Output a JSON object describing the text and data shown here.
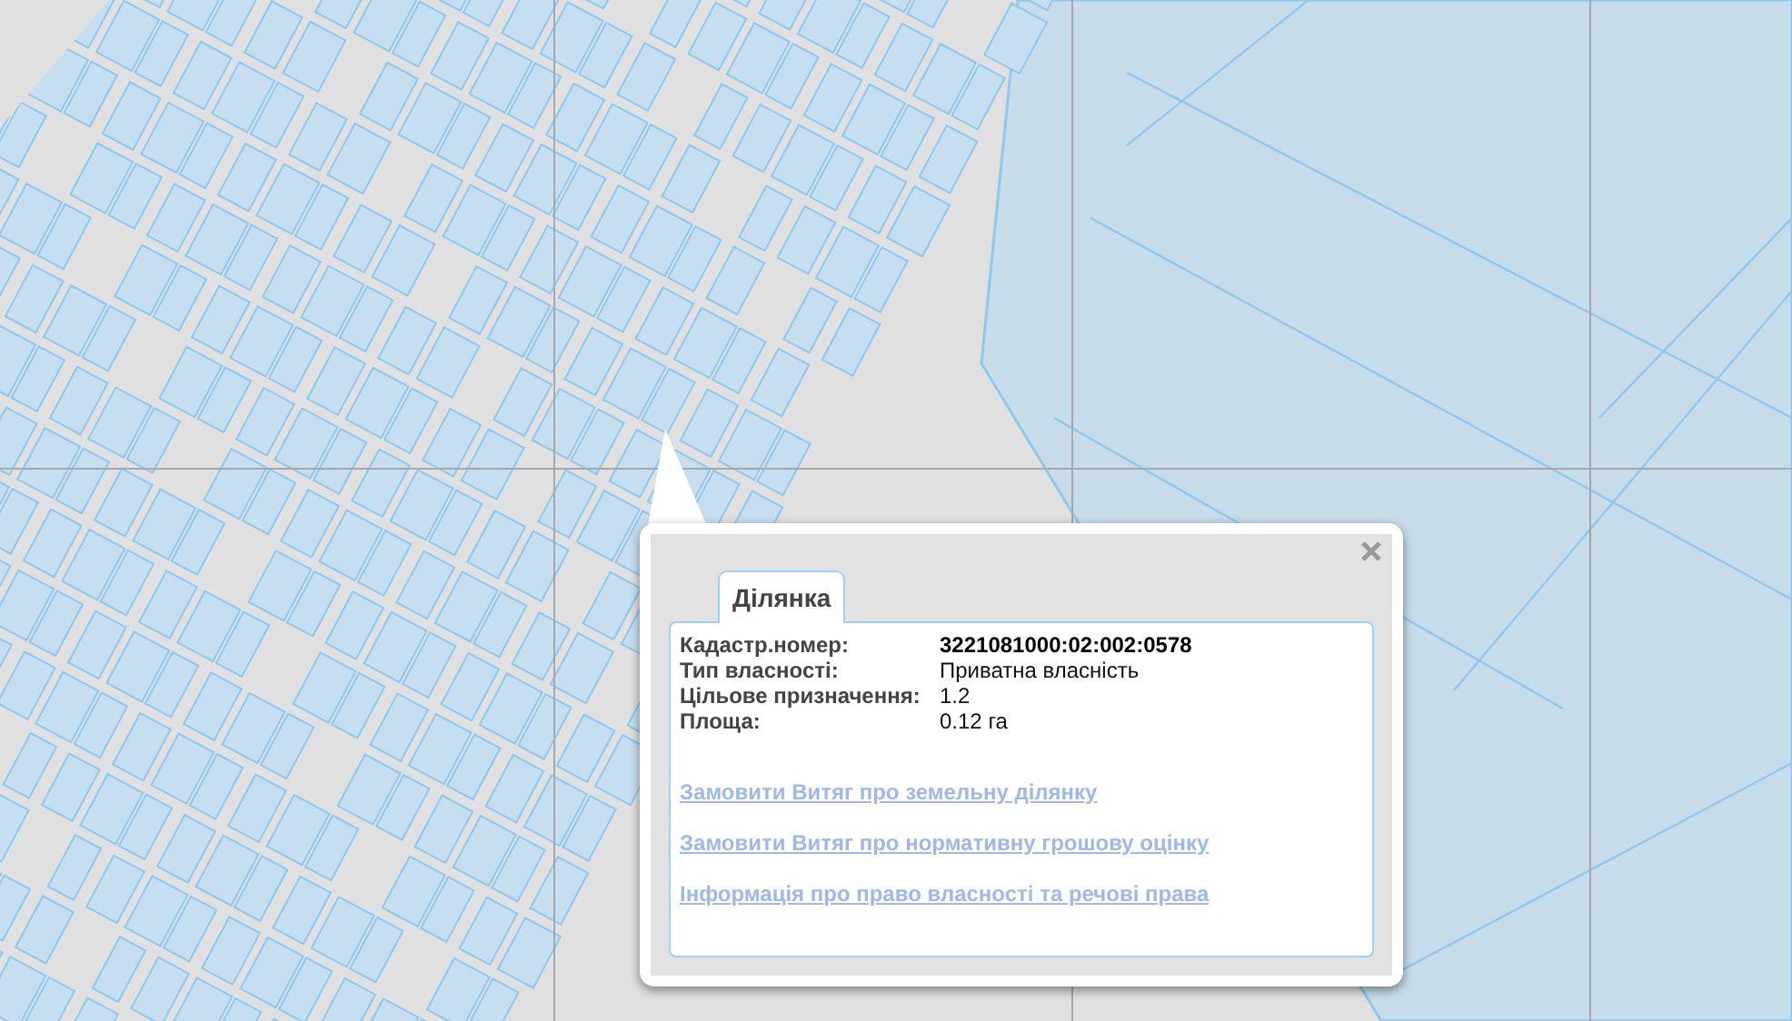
{
  "popup": {
    "tab": {
      "label": "Ділянка",
      "selected": true
    },
    "fields": [
      {
        "label": "Кадастр.номер:",
        "value": "3221081000:02:002:0578",
        "bold": true
      },
      {
        "label": "Тип власності:",
        "value": "Приватна власність",
        "bold": false
      },
      {
        "label": "Цільове призначення:",
        "value": "1.2",
        "bold": false
      },
      {
        "label": "Площа:",
        "value": "0.12 га",
        "bold": false
      }
    ],
    "links": [
      "Замовити Витяг про земельну ділянку",
      "Замовити Витяг про нормативну грошову оцінку",
      "Інформація про право власності та речові права"
    ]
  }
}
